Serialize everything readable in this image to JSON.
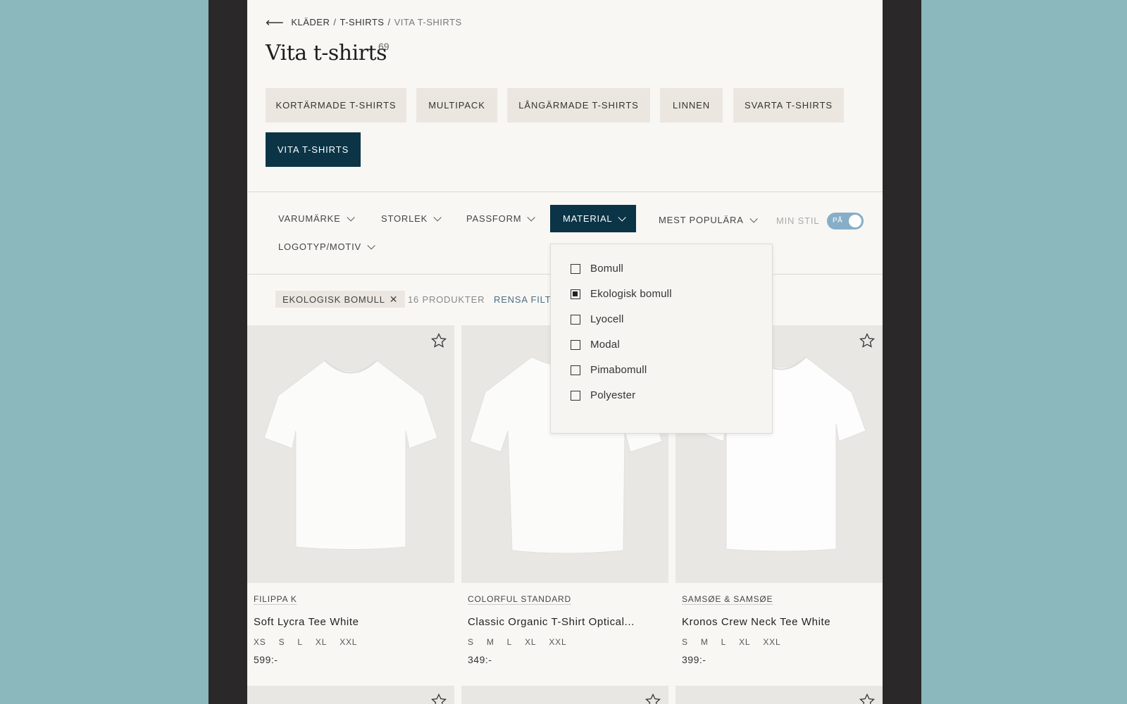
{
  "breadcrumb": {
    "back_icon": "arrow-left-icon",
    "items": [
      "KLÄDER",
      "T-SHIRTS",
      "VITA T-SHIRTS"
    ]
  },
  "page": {
    "title": "Vita t-shirts",
    "count": "69"
  },
  "categories": [
    {
      "label": "KORTÄRMADE T-SHIRTS",
      "active": false
    },
    {
      "label": "MULTIPACK",
      "active": false
    },
    {
      "label": "LÅNGÄRMADE T-SHIRTS",
      "active": false
    },
    {
      "label": "LINNEN",
      "active": false
    },
    {
      "label": "SVARTA T-SHIRTS",
      "active": false
    },
    {
      "label": "VITA T-SHIRTS",
      "active": true
    }
  ],
  "filters": {
    "brand": "VARUMÄRKE",
    "size": "STORLEK",
    "fit": "PASSFORM",
    "material": "MATERIAL",
    "sort": "MEST POPULÄRA",
    "logo": "LOGOTYP/MOTIV",
    "my_style_label": "MIN STIL",
    "my_style_toggle": "PÅ",
    "my_style_on": true
  },
  "material_options": [
    {
      "label": "Bomull",
      "checked": false
    },
    {
      "label": "Ekologisk bomull",
      "checked": true
    },
    {
      "label": "Lyocell",
      "checked": false
    },
    {
      "label": "Modal",
      "checked": false
    },
    {
      "label": "Pimabomull",
      "checked": false
    },
    {
      "label": "Polyester",
      "checked": false
    }
  ],
  "applied": {
    "chip": "EKOLOGISK BOMULL",
    "count": "16 PRODUKTER",
    "clear": "RENSA FILT"
  },
  "products": [
    {
      "brand": "FILIPPA K",
      "name": "Soft Lycra Tee White",
      "sizes": [
        "XS",
        "S",
        "L",
        "XL",
        "XXL"
      ],
      "price": "599:-"
    },
    {
      "brand": "COLORFUL STANDARD",
      "name": "Classic Organic T-Shirt Optical...",
      "sizes": [
        "S",
        "M",
        "L",
        "XL",
        "XXL"
      ],
      "price": "349:-"
    },
    {
      "brand": "SAMSØE & SAMSØE",
      "name": "Kronos Crew Neck Tee White",
      "sizes": [
        "S",
        "M",
        "L",
        "XL",
        "XXL"
      ],
      "price": "399:-"
    }
  ],
  "colors": {
    "accent": "#0b3447",
    "chip_bg": "#ebe7e0",
    "background": "#8ab8bc",
    "page_bg": "#f8f7f4"
  }
}
